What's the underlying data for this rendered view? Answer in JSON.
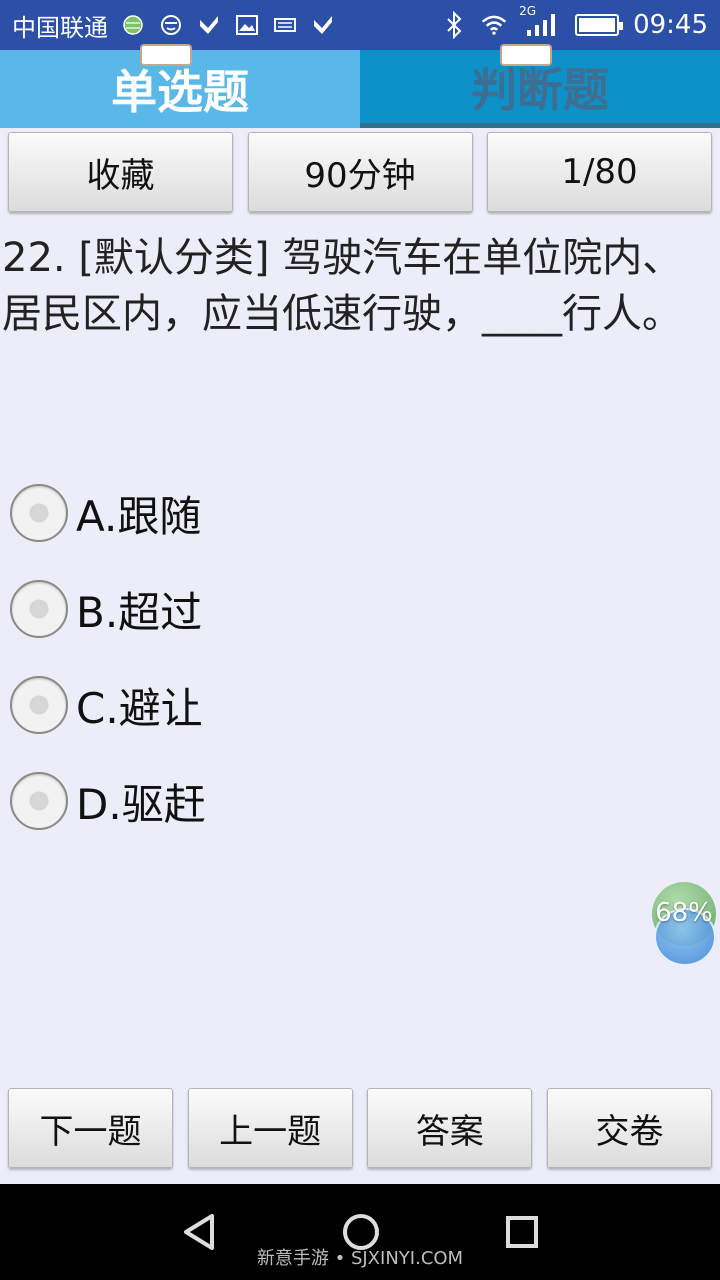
{
  "status_bar": {
    "carrier": "中国联通",
    "network": "2G",
    "time": "09:45"
  },
  "tabs": [
    {
      "label": "单选题",
      "active": true
    },
    {
      "label": "判断题",
      "active": false
    }
  ],
  "toolbar": {
    "favorite_label": "收藏",
    "timer_label": "90分钟",
    "progress_label": "1/80"
  },
  "question": {
    "text": "22. [默认分类] 驾驶汽车在单位院内、居民区内，应当低速行驶，____行人。"
  },
  "options": [
    {
      "label": "A.跟随"
    },
    {
      "label": "B.超过"
    },
    {
      "label": "C.避让"
    },
    {
      "label": "D.驱赶"
    }
  ],
  "floating_ball": {
    "percent": "68%"
  },
  "bottom_bar": {
    "next_label": "下一题",
    "prev_label": "上一题",
    "answer_label": "答案",
    "submit_label": "交卷"
  },
  "nav_bar": {
    "watermark": "新意手游 • SJXINYI.COM"
  },
  "colors": {
    "status_bg": "#2c4fa8",
    "tab_active_bg": "#5ab8e8",
    "tab_inactive_bg": "#0c92c8",
    "page_bg": "#ecedf8"
  }
}
